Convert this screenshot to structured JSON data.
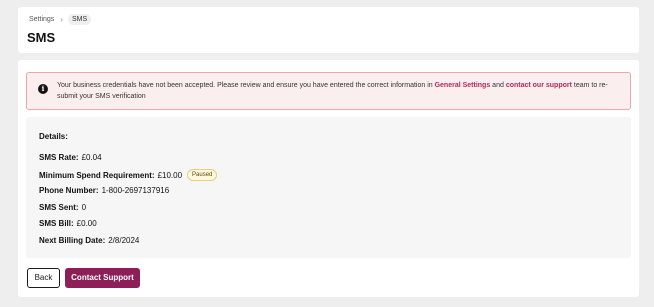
{
  "breadcrumb": {
    "items": [
      "Settings",
      "SMS"
    ],
    "separator": "›"
  },
  "page": {
    "title": "SMS"
  },
  "alert": {
    "icon": "info-icon",
    "text_before": "Your business credentials have not been accepted. Please review and ensure you have entered the correct information in ",
    "link1": "General Settings",
    "text_middle": " and ",
    "link2": "contact our support",
    "text_after": " team to re-submit your SMS verification",
    "link_color": "#b32a5a",
    "background": "#fbeeee"
  },
  "details": {
    "title": "Details:",
    "rows": [
      {
        "label": "SMS Rate:",
        "value": "£0.04"
      },
      {
        "label": "Minimum Spend Requirement:",
        "value": "£10.00",
        "badge": "Paused"
      },
      {
        "label": "Phone Number:",
        "value": "1-800-2697137916"
      },
      {
        "label": "SMS Sent:",
        "value": "0"
      },
      {
        "label": "SMS Bill:",
        "value": "£0.00"
      },
      {
        "label": "Next Billing Date:",
        "value": "2/8/2024"
      }
    ]
  },
  "actions": {
    "back_label": "Back",
    "contact_label": "Contact Support",
    "primary_color": "#8e1e58"
  }
}
